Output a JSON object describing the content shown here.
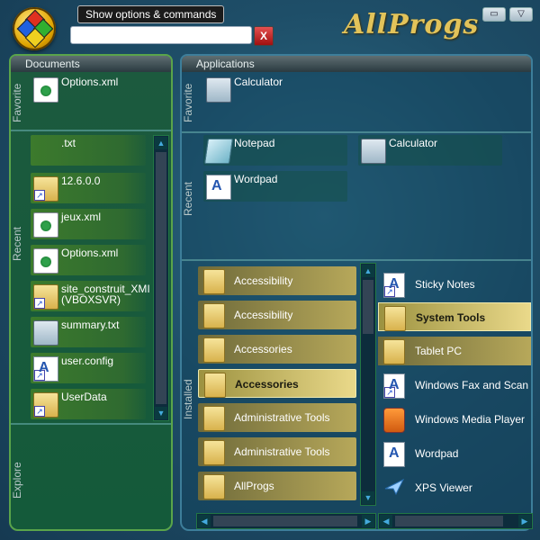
{
  "header": {
    "tooltip": "Show options & commands",
    "search_value": "",
    "clear_label": "X",
    "brand": "AllProgs",
    "window_buttons": [
      "▭",
      "▽"
    ]
  },
  "documents": {
    "header": "Documents",
    "labels": {
      "favorite": "Favorite",
      "recent": "Recent",
      "explore": "Explore"
    },
    "favorite": [
      {
        "label": "Options.xml",
        "icon": "xml-doc-icon"
      }
    ],
    "recent": [
      {
        "label": ".txt",
        "icon": "none"
      },
      {
        "label": "12.6.0.0",
        "icon": "folder-shortcut-icon"
      },
      {
        "label": "jeux.xml",
        "icon": "xml-doc-icon"
      },
      {
        "label": "Options.xml",
        "icon": "xml-doc-icon"
      },
      {
        "label": "site_construit_XMI (VBOXSVR)",
        "icon": "folder-shortcut-icon"
      },
      {
        "label": "summary.txt",
        "icon": "network-doc-icon"
      },
      {
        "label": "user.config",
        "icon": "file-shortcut-icon"
      },
      {
        "label": "UserData",
        "icon": "folder-shortcut-icon"
      }
    ]
  },
  "applications": {
    "header": "Applications",
    "labels": {
      "favorite": "Favorite",
      "recent": "Recent",
      "installed": "Installed"
    },
    "favorite": [
      {
        "label": "Calculator",
        "icon": "calculator-icon"
      }
    ],
    "recent": [
      {
        "label": "Notepad",
        "icon": "notepad-icon"
      },
      {
        "label": "Calculator",
        "icon": "calculator-icon"
      },
      {
        "label": "Wordpad",
        "icon": "wordpad-icon"
      }
    ],
    "installed_left": [
      {
        "label": "Accessibility"
      },
      {
        "label": "Accessibility"
      },
      {
        "label": "Accessories"
      },
      {
        "label": "Accessories",
        "selected": true
      },
      {
        "label": "Administrative Tools"
      },
      {
        "label": "Administrative Tools"
      },
      {
        "label": "AllProgs"
      }
    ],
    "installed_right": [
      {
        "label": "Sticky Notes",
        "icon": "sticky-notes-icon"
      },
      {
        "label": "System Tools",
        "icon": "folder-icon",
        "selected": true
      },
      {
        "label": "Tablet PC",
        "icon": "folder-icon",
        "highlight": true
      },
      {
        "label": "Windows Fax and Scan",
        "icon": "fax-icon"
      },
      {
        "label": "Windows Media Player",
        "icon": "media-player-icon"
      },
      {
        "label": "Wordpad",
        "icon": "wordpad-icon"
      },
      {
        "label": "XPS Viewer",
        "icon": "xps-viewer-icon"
      }
    ]
  }
}
